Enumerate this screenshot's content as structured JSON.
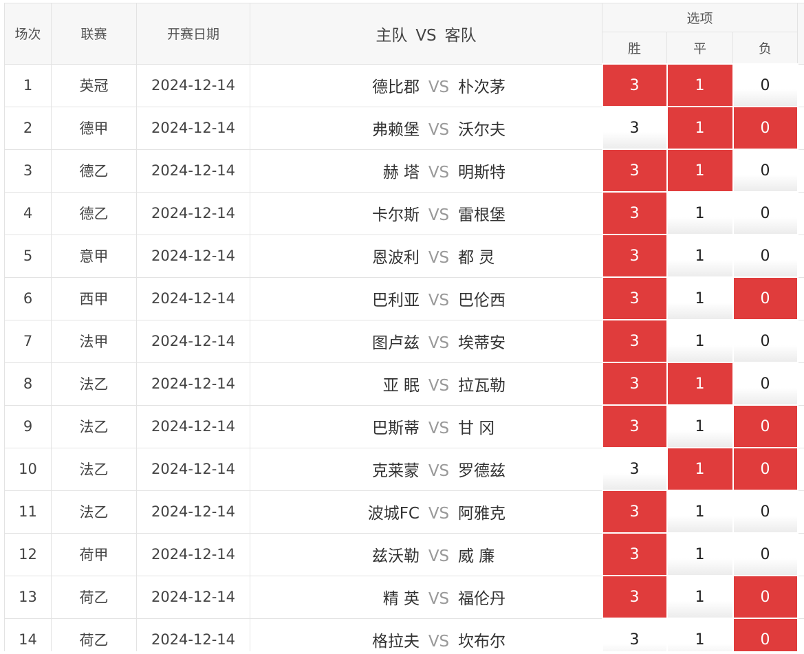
{
  "headers": {
    "num": "场次",
    "league": "联赛",
    "date": "开赛日期",
    "home": "主队",
    "vs": "VS",
    "away": "客队",
    "options": "选项",
    "win": "胜",
    "draw": "平",
    "lose": "负"
  },
  "colors": {
    "selected": "#e03c3c",
    "header_bg": "#f7f7f7"
  },
  "matches": [
    {
      "num": "1",
      "league": "英冠",
      "date": "2024-12-14",
      "home": "德比郡",
      "vs": "VS",
      "away": "朴次茅",
      "win": "3",
      "draw": "1",
      "lose": "0",
      "sel": [
        true,
        true,
        false
      ]
    },
    {
      "num": "2",
      "league": "德甲",
      "date": "2024-12-14",
      "home": "弗赖堡",
      "vs": "VS",
      "away": "沃尔夫",
      "win": "3",
      "draw": "1",
      "lose": "0",
      "sel": [
        false,
        true,
        true
      ]
    },
    {
      "num": "3",
      "league": "德乙",
      "date": "2024-12-14",
      "home": "赫 塔",
      "vs": "VS",
      "away": "明斯特",
      "win": "3",
      "draw": "1",
      "lose": "0",
      "sel": [
        true,
        true,
        false
      ]
    },
    {
      "num": "4",
      "league": "德乙",
      "date": "2024-12-14",
      "home": "卡尔斯",
      "vs": "VS",
      "away": "雷根堡",
      "win": "3",
      "draw": "1",
      "lose": "0",
      "sel": [
        true,
        false,
        false
      ]
    },
    {
      "num": "5",
      "league": "意甲",
      "date": "2024-12-14",
      "home": "恩波利",
      "vs": "VS",
      "away": "都 灵",
      "win": "3",
      "draw": "1",
      "lose": "0",
      "sel": [
        true,
        false,
        false
      ]
    },
    {
      "num": "6",
      "league": "西甲",
      "date": "2024-12-14",
      "home": "巴利亚",
      "vs": "VS",
      "away": "巴伦西",
      "win": "3",
      "draw": "1",
      "lose": "0",
      "sel": [
        true,
        false,
        true
      ]
    },
    {
      "num": "7",
      "league": "法甲",
      "date": "2024-12-14",
      "home": "图卢兹",
      "vs": "VS",
      "away": "埃蒂安",
      "win": "3",
      "draw": "1",
      "lose": "0",
      "sel": [
        true,
        false,
        false
      ]
    },
    {
      "num": "8",
      "league": "法乙",
      "date": "2024-12-14",
      "home": "亚 眠",
      "vs": "VS",
      "away": "拉瓦勒",
      "win": "3",
      "draw": "1",
      "lose": "0",
      "sel": [
        true,
        true,
        false
      ]
    },
    {
      "num": "9",
      "league": "法乙",
      "date": "2024-12-14",
      "home": "巴斯蒂",
      "vs": "VS",
      "away": "甘 冈",
      "win": "3",
      "draw": "1",
      "lose": "0",
      "sel": [
        true,
        false,
        true
      ]
    },
    {
      "num": "10",
      "league": "法乙",
      "date": "2024-12-14",
      "home": "克莱蒙",
      "vs": "VS",
      "away": "罗德兹",
      "win": "3",
      "draw": "1",
      "lose": "0",
      "sel": [
        false,
        true,
        true
      ]
    },
    {
      "num": "11",
      "league": "法乙",
      "date": "2024-12-14",
      "home": "波城FC",
      "vs": "VS",
      "away": "阿雅克",
      "win": "3",
      "draw": "1",
      "lose": "0",
      "sel": [
        true,
        false,
        false
      ]
    },
    {
      "num": "12",
      "league": "荷甲",
      "date": "2024-12-14",
      "home": "兹沃勒",
      "vs": "VS",
      "away": "威 廉",
      "win": "3",
      "draw": "1",
      "lose": "0",
      "sel": [
        true,
        false,
        false
      ]
    },
    {
      "num": "13",
      "league": "荷乙",
      "date": "2024-12-14",
      "home": "精 英",
      "vs": "VS",
      "away": "福伦丹",
      "win": "3",
      "draw": "1",
      "lose": "0",
      "sel": [
        true,
        false,
        true
      ]
    },
    {
      "num": "14",
      "league": "荷乙",
      "date": "2024-12-14",
      "home": "格拉夫",
      "vs": "VS",
      "away": "坎布尔",
      "win": "3",
      "draw": "1",
      "lose": "0",
      "sel": [
        false,
        false,
        true
      ]
    }
  ]
}
